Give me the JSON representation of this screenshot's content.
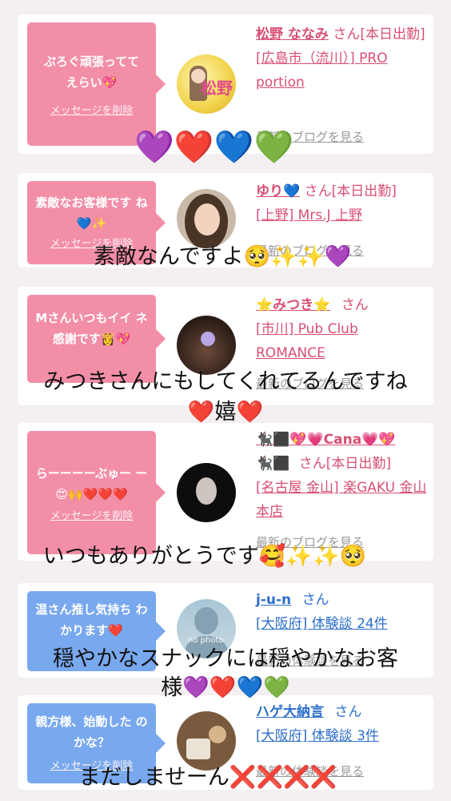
{
  "cards": [
    {
      "bubble_msg": "ぷろぐ頑張ってて えらい💖",
      "delete_label": "メッセージを削除",
      "name": "松野 ななみ",
      "san": "さん[本日出勤]",
      "shop": "[広島市（流川）] PRO portion",
      "blog": "最新のブログを見る",
      "avatar_text": "松野"
    },
    {
      "bubble_msg": "素敵なお客様です ね💙✨",
      "delete_label": "メッセージを削除",
      "name": "ゆり💙",
      "san": "さん[本日出勤]",
      "shop": "[上野] Mrs.J 上野",
      "blog": "最新のブログを見る"
    },
    {
      "bubble_msg": "Mさんいつもイイ ネ感謝です👸💖",
      "delete_label": "メッセージを削除",
      "name": "⭐みつき⭐",
      "san": "さん",
      "shop": "[市川] Pub Club ROMANCE",
      "blog": "最新のブログを見る"
    },
    {
      "bubble_msg": "らーーーーぶゅー ー😍🙌❤️❤️❤️",
      "delete_label": "メッセージを削除",
      "name": "🐈‍⬛⬛💖💗Cana💗💖",
      "name2": "🐈‍⬛⬛",
      "san": "さん[本日出勤]",
      "shop": "[名古屋 金山] 楽GAKU 金山本店",
      "blog": "最新のブログを見る"
    },
    {
      "bubble_msg": "温さん推し気持ち わかります❤️",
      "delete_label": "メッセージを削除",
      "name": "j-u-n",
      "san": "さん",
      "shop": "[大阪府] 体験談 24件",
      "blog": "最新の体験談を見る",
      "avatar_text": "no photo"
    },
    {
      "bubble_msg": "親方様、始動した のかな？",
      "delete_label": "メッセージを削除",
      "name": "ハゲ大納言",
      "san": "さん",
      "shop": "[大阪府] 体験談 3件",
      "blog": "最新の体験談を見る"
    }
  ],
  "overlays": {
    "hearts1": [
      "💜",
      "❤️",
      "💙",
      "💚"
    ],
    "line1": "素敵なんですよ🥺✨✨💜",
    "line2": "みつきさんにもしてくれてるんですね",
    "line2b": "❤️嬉❤️",
    "line3": "いつもありがとうです🥰✨✨🥺",
    "line4": "穏やかなスナックには穏やかなお客",
    "line4b": "様💜❤️💙💚",
    "line5": "まだしませーん❌❌❌❌"
  }
}
